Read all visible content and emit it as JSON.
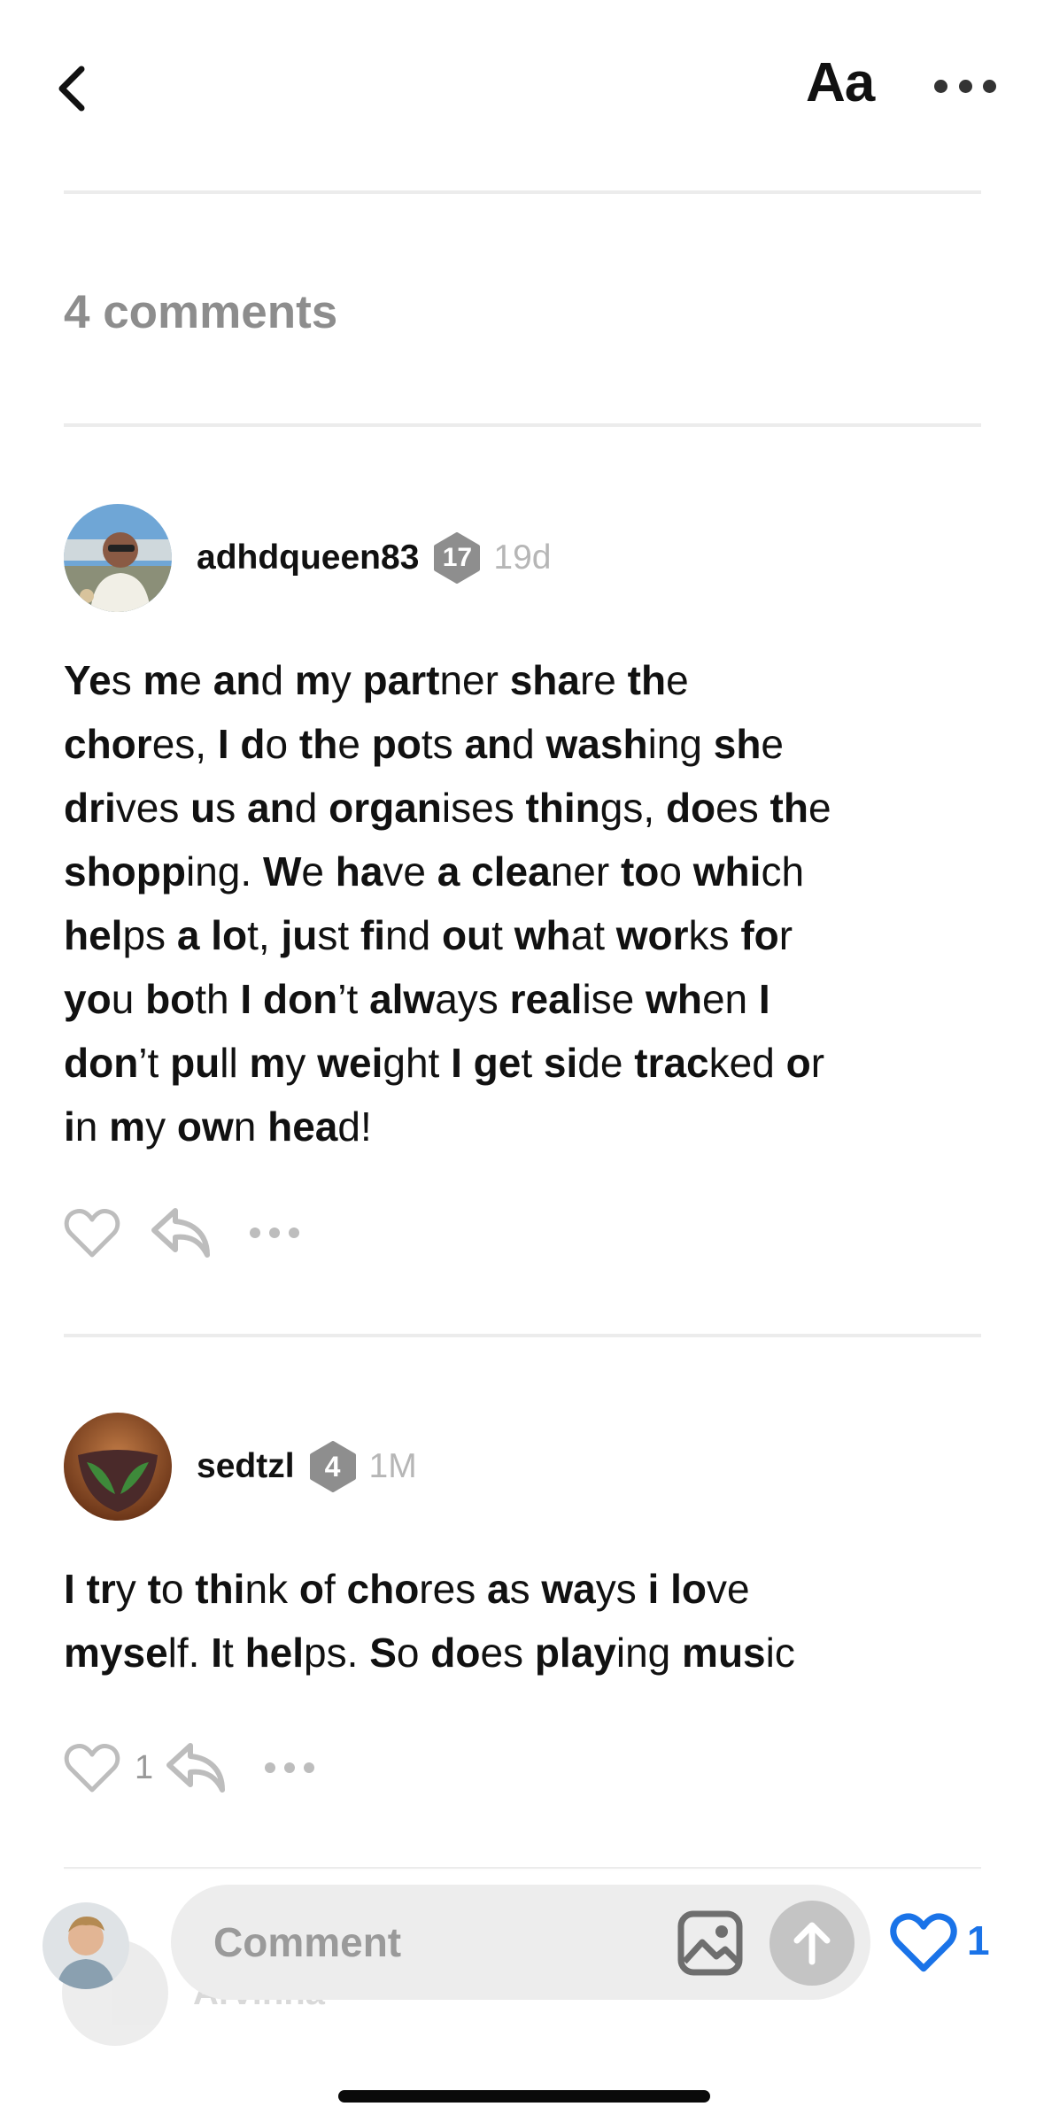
{
  "header": {
    "font_button_label": "Aa"
  },
  "comments_section": {
    "count_label": "4 comments"
  },
  "comments": [
    {
      "username": "adhdqueen83",
      "level": "17",
      "age": "19d",
      "likes": "",
      "body_parts": [
        [
          "b",
          "Ye"
        ],
        [
          "r",
          "s "
        ],
        [
          "b",
          "m"
        ],
        [
          "r",
          "e "
        ],
        [
          "b",
          "an"
        ],
        [
          "r",
          "d "
        ],
        [
          "b",
          "m"
        ],
        [
          "r",
          "y "
        ],
        [
          "b",
          "part"
        ],
        [
          "r",
          "ner "
        ],
        [
          "b",
          "sha"
        ],
        [
          "r",
          "re "
        ],
        [
          "b",
          "th"
        ],
        [
          "r",
          "e"
        ],
        [
          "r",
          "\n"
        ],
        [
          "b",
          "chor"
        ],
        [
          "r",
          "es, "
        ],
        [
          "b",
          "I d"
        ],
        [
          "r",
          "o "
        ],
        [
          "b",
          "th"
        ],
        [
          "r",
          "e "
        ],
        [
          "b",
          "po"
        ],
        [
          "r",
          "ts "
        ],
        [
          "b",
          "an"
        ],
        [
          "r",
          "d "
        ],
        [
          "b",
          "wash"
        ],
        [
          "r",
          "ing "
        ],
        [
          "b",
          "sh"
        ],
        [
          "r",
          "e"
        ],
        [
          "r",
          "\n"
        ],
        [
          "b",
          "dri"
        ],
        [
          "r",
          "ves "
        ],
        [
          "b",
          "u"
        ],
        [
          "r",
          "s "
        ],
        [
          "b",
          "an"
        ],
        [
          "r",
          "d "
        ],
        [
          "b",
          "organ"
        ],
        [
          "r",
          "ises "
        ],
        [
          "b",
          "thin"
        ],
        [
          "r",
          "gs, "
        ],
        [
          "b",
          "do"
        ],
        [
          "r",
          "es "
        ],
        [
          "b",
          "th"
        ],
        [
          "r",
          "e"
        ],
        [
          "r",
          "\n"
        ],
        [
          "b",
          "shopp"
        ],
        [
          "r",
          "ing. "
        ],
        [
          "b",
          "W"
        ],
        [
          "r",
          "e "
        ],
        [
          "b",
          "ha"
        ],
        [
          "r",
          "ve "
        ],
        [
          "b",
          "a clea"
        ],
        [
          "r",
          "ner "
        ],
        [
          "b",
          "to"
        ],
        [
          "r",
          "o "
        ],
        [
          "b",
          "whi"
        ],
        [
          "r",
          "ch"
        ],
        [
          "r",
          "\n"
        ],
        [
          "b",
          "hel"
        ],
        [
          "r",
          "ps "
        ],
        [
          "b",
          "a lo"
        ],
        [
          "r",
          "t, "
        ],
        [
          "b",
          "ju"
        ],
        [
          "r",
          "st "
        ],
        [
          "b",
          "fi"
        ],
        [
          "r",
          "nd "
        ],
        [
          "b",
          "ou"
        ],
        [
          "r",
          "t "
        ],
        [
          "b",
          "wh"
        ],
        [
          "r",
          "at "
        ],
        [
          "b",
          "wor"
        ],
        [
          "r",
          "ks "
        ],
        [
          "b",
          "fo"
        ],
        [
          "r",
          "r"
        ],
        [
          "r",
          "\n"
        ],
        [
          "b",
          "yo"
        ],
        [
          "r",
          "u "
        ],
        [
          "b",
          "bo"
        ],
        [
          "r",
          "th "
        ],
        [
          "b",
          "I don"
        ],
        [
          "r",
          "’t "
        ],
        [
          "b",
          "alw"
        ],
        [
          "r",
          "ays "
        ],
        [
          "b",
          "real"
        ],
        [
          "r",
          "ise "
        ],
        [
          "b",
          "wh"
        ],
        [
          "r",
          "en "
        ],
        [
          "b",
          "I"
        ],
        [
          "r",
          "\n"
        ],
        [
          "b",
          "don"
        ],
        [
          "r",
          "’t "
        ],
        [
          "b",
          "pu"
        ],
        [
          "r",
          "ll "
        ],
        [
          "b",
          "m"
        ],
        [
          "r",
          "y "
        ],
        [
          "b",
          "wei"
        ],
        [
          "r",
          "ght "
        ],
        [
          "b",
          "I ge"
        ],
        [
          "r",
          "t "
        ],
        [
          "b",
          "si"
        ],
        [
          "r",
          "de "
        ],
        [
          "b",
          "trac"
        ],
        [
          "r",
          "ked "
        ],
        [
          "b",
          "o"
        ],
        [
          "r",
          "r"
        ],
        [
          "r",
          "\n"
        ],
        [
          "b",
          "i"
        ],
        [
          "r",
          "n "
        ],
        [
          "b",
          "m"
        ],
        [
          "r",
          "y "
        ],
        [
          "b",
          "ow"
        ],
        [
          "r",
          "n "
        ],
        [
          "b",
          "hea"
        ],
        [
          "r",
          "d!"
        ]
      ]
    },
    {
      "username": "sedtzl",
      "level": "4",
      "age": "1M",
      "likes": "1",
      "body_parts": [
        [
          "b",
          "I tr"
        ],
        [
          "r",
          "y "
        ],
        [
          "b",
          "t"
        ],
        [
          "r",
          "o "
        ],
        [
          "b",
          "thi"
        ],
        [
          "r",
          "nk "
        ],
        [
          "b",
          "o"
        ],
        [
          "r",
          "f "
        ],
        [
          "b",
          "cho"
        ],
        [
          "r",
          "res "
        ],
        [
          "b",
          "a"
        ],
        [
          "r",
          "s "
        ],
        [
          "b",
          "wa"
        ],
        [
          "r",
          "ys "
        ],
        [
          "b",
          "i lo"
        ],
        [
          "r",
          "ve"
        ],
        [
          "r",
          "\n"
        ],
        [
          "b",
          "myse"
        ],
        [
          "r",
          "lf. "
        ],
        [
          "b",
          "I"
        ],
        [
          "r",
          "t "
        ],
        [
          "b",
          "hel"
        ],
        [
          "r",
          "ps. "
        ],
        [
          "b",
          "S"
        ],
        [
          "r",
          "o "
        ],
        [
          "b",
          "do"
        ],
        [
          "r",
          "es "
        ],
        [
          "b",
          "play"
        ],
        [
          "r",
          "ing "
        ],
        [
          "b",
          "mus"
        ],
        [
          "r",
          "ic"
        ]
      ]
    }
  ],
  "ghost_comment": {
    "username": "Arvinna"
  },
  "composer": {
    "placeholder": "Comment",
    "like_count": "1"
  },
  "colors": {
    "accent": "#1a73e8",
    "muted": "#8d8d8d",
    "badge": "#8e8e8e"
  }
}
